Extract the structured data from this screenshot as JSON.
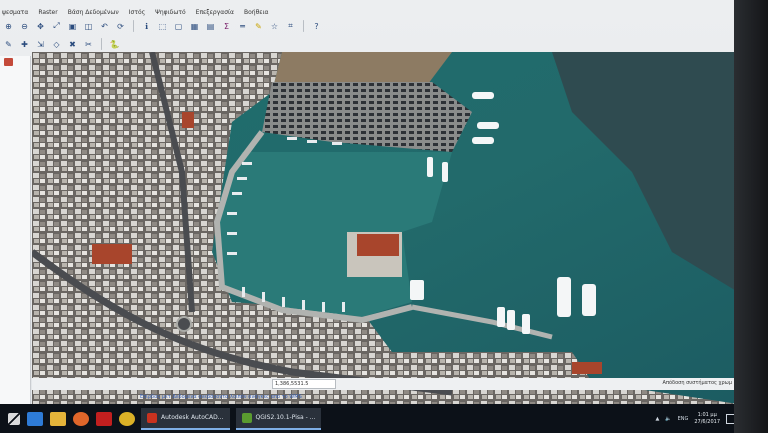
{
  "app": {
    "menu": [
      "ψεσματα",
      "Raster",
      "Βάση Δεδομένων",
      "Ιστός",
      "Ψηφιδωτό",
      "Επεξεργασία",
      "Βοήθεια"
    ]
  },
  "toolbar": {
    "icons": [
      "zoom-in-icon",
      "zoom-out-icon",
      "pan-icon",
      "zoom-full-icon",
      "zoom-layer-icon",
      "zoom-selection-icon",
      "zoom-last-icon",
      "refresh-icon",
      "identify-icon",
      "select-icon",
      "deselect-icon",
      "attribute-table-icon",
      "field-calc-icon",
      "sum-icon",
      "measure-icon",
      "annotation-icon",
      "tips-icon",
      "label-icon",
      "help-icon",
      "python-icon"
    ]
  },
  "statusbar": {
    "coordinate": "1,386,5531.5",
    "render_label": "Απόδοση συστήματος χρωμ"
  },
  "map_link": "Επίρδας μετ Δεδομένα ανεβάνοντα λοιπόν ανάγκες από το WMS",
  "taskbar": {
    "apps": [
      {
        "label": "Autodesk AutoCAD...",
        "color": "#c8321f"
      },
      {
        "label": "QGIS2.10.1-Pisa - ...",
        "color": "#5a9b2f"
      }
    ],
    "language": "ENG",
    "time": "1:01 μμ",
    "date": "27/6/2017"
  },
  "colors": {
    "water": "#235a5d",
    "water_deep": "#2b4a4f",
    "quay": "#9aa0a2",
    "city": "#6e6a66",
    "roof_red": "#a8452c"
  }
}
